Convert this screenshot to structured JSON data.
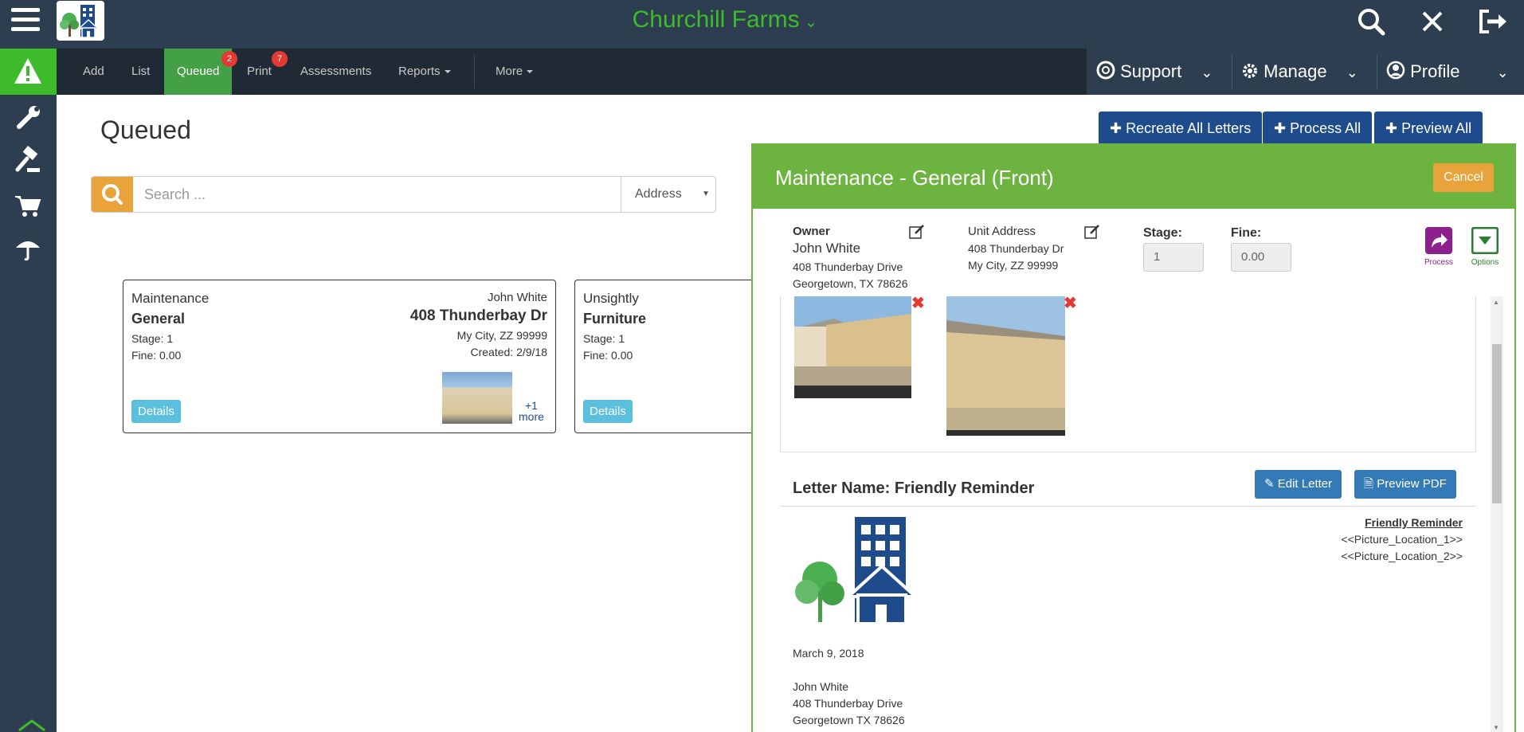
{
  "app": {
    "title": "Churchill Farms"
  },
  "nav": {
    "items": [
      {
        "label": "Add"
      },
      {
        "label": "List"
      },
      {
        "label": "Queued",
        "badge": "2"
      },
      {
        "label": "Print",
        "badge": "7"
      },
      {
        "label": "Assessments"
      },
      {
        "label": "Reports"
      },
      {
        "label": "More"
      }
    ],
    "right": {
      "support": "Support",
      "manage": "Manage",
      "profile": "Profile"
    }
  },
  "page": {
    "title": "Queued",
    "actions": {
      "recreate": "Recreate All Letters",
      "process": "Process All",
      "preview": "Preview All"
    }
  },
  "search": {
    "placeholder": "Search ...",
    "filter": "Address"
  },
  "cards": [
    {
      "category": "Maintenance",
      "type": "General",
      "stage": "Stage: 1",
      "fine": "Fine: 0.00",
      "owner": "John White",
      "address": "408 Thunderbay Dr",
      "city": "My City, ZZ 99999",
      "created": "Created: 2/9/18",
      "more_count": "+1",
      "more_label": "more",
      "details": "Details"
    },
    {
      "category": "Unsightly",
      "type": "Furniture",
      "stage": "Stage: 1",
      "fine": "Fine: 0.00",
      "details": "Details"
    }
  ],
  "modal": {
    "title": "Maintenance - General (Front)",
    "cancel": "Cancel",
    "owner_label": "Owner",
    "owner_name": "John White",
    "owner_street": "408 Thunderbay Drive",
    "owner_city": "Georgetown, TX 78626",
    "unit_label": "Unit Address",
    "unit_street": "408 Thunderbay Dr",
    "unit_city": "My City, ZZ 99999",
    "stage_label": "Stage:",
    "stage_value": "1",
    "fine_label": "Fine:",
    "fine_value": "0.00",
    "process": "Process",
    "options": "Options",
    "letter_title": "Letter Name: Friendly Reminder",
    "edit_letter": "Edit Letter",
    "preview_pdf": "Preview PDF",
    "letter": {
      "heading": "Friendly Reminder",
      "loc1": "<<Picture_Location_1>>",
      "loc2": "<<Picture_Location_2>>",
      "date": "March 9, 2018",
      "recipient_name": "John White",
      "recipient_street": "408 Thunderbay Drive",
      "recipient_city": "Georgetown TX 78626"
    }
  },
  "colors": {
    "topbar": "#2d3e50",
    "accent_green": "#3dbb2a",
    "modal_green": "#6cb33f",
    "primary_blue": "#1e4b8c",
    "orange": "#e8a33a"
  }
}
